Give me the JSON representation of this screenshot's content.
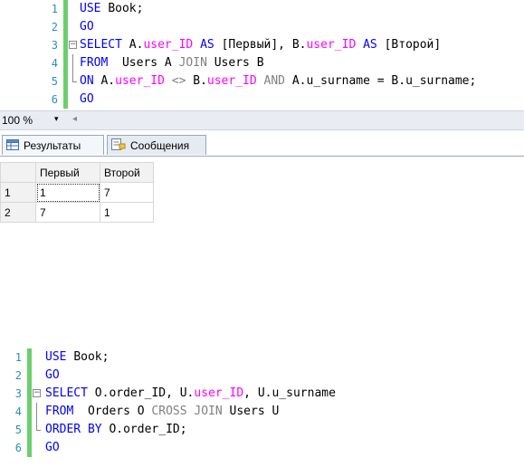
{
  "query1": {
    "lines": [
      {
        "num": "1",
        "parts": [
          {
            "t": "USE ",
            "c": "kw"
          },
          {
            "t": "Book;",
            "c": "txt"
          }
        ]
      },
      {
        "num": "2",
        "parts": [
          {
            "t": "GO",
            "c": "kw"
          }
        ]
      },
      {
        "num": "3",
        "parts": [
          {
            "t": "SELECT ",
            "c": "kw"
          },
          {
            "t": "A.",
            "c": "txt"
          },
          {
            "t": "user_ID",
            "c": "fn"
          },
          {
            "t": " AS ",
            "c": "kw"
          },
          {
            "t": "[Первый], B.",
            "c": "txt"
          },
          {
            "t": "user_ID",
            "c": "fn"
          },
          {
            "t": " AS ",
            "c": "kw"
          },
          {
            "t": "[Второй]",
            "c": "txt"
          }
        ]
      },
      {
        "num": "4",
        "parts": [
          {
            "t": "FROM ",
            "c": "kw"
          },
          {
            "t": " Users A ",
            "c": "txt"
          },
          {
            "t": "JOIN",
            "c": "gray"
          },
          {
            "t": " Users B",
            "c": "txt"
          }
        ]
      },
      {
        "num": "5",
        "parts": [
          {
            "t": "ON ",
            "c": "kw"
          },
          {
            "t": "A.",
            "c": "txt"
          },
          {
            "t": "user_ID",
            "c": "fn"
          },
          {
            "t": " <> ",
            "c": "gray"
          },
          {
            "t": "B.",
            "c": "txt"
          },
          {
            "t": "user_ID",
            "c": "fn"
          },
          {
            "t": " AND ",
            "c": "gray"
          },
          {
            "t": "A.u_surname = B.u_surname;",
            "c": "txt"
          }
        ]
      },
      {
        "num": "6",
        "parts": [
          {
            "t": "GO",
            "c": "kw"
          }
        ]
      }
    ]
  },
  "status": {
    "zoom": "100 %",
    "zoom_arrow": "▾",
    "scroll_left": "◂"
  },
  "tabs": {
    "results": "Результаты",
    "messages": "Сообщения"
  },
  "results_grid": {
    "columns": [
      "Первый",
      "Второй"
    ],
    "rows": [
      {
        "n": "1",
        "v": [
          "1",
          "7"
        ]
      },
      {
        "n": "2",
        "v": [
          "7",
          "1"
        ]
      }
    ]
  },
  "query2": {
    "lines": [
      {
        "num": "1",
        "parts": [
          {
            "t": "USE ",
            "c": "kw"
          },
          {
            "t": "Book;",
            "c": "txt"
          }
        ]
      },
      {
        "num": "2",
        "parts": [
          {
            "t": "GO",
            "c": "kw"
          }
        ]
      },
      {
        "num": "3",
        "parts": [
          {
            "t": "SELECT ",
            "c": "kw"
          },
          {
            "t": "O.order_ID, U.",
            "c": "txt"
          },
          {
            "t": "user_ID",
            "c": "fn"
          },
          {
            "t": ", U.u_surname",
            "c": "txt"
          }
        ]
      },
      {
        "num": "4",
        "parts": [
          {
            "t": "FROM ",
            "c": "kw"
          },
          {
            "t": " Orders O ",
            "c": "txt"
          },
          {
            "t": "CROSS JOIN",
            "c": "gray"
          },
          {
            "t": " Users U",
            "c": "txt"
          }
        ]
      },
      {
        "num": "5",
        "parts": [
          {
            "t": "ORDER BY ",
            "c": "kw"
          },
          {
            "t": "O.order_ID;",
            "c": "txt"
          }
        ]
      },
      {
        "num": "6",
        "parts": [
          {
            "t": "GO",
            "c": "kw"
          }
        ]
      }
    ]
  }
}
